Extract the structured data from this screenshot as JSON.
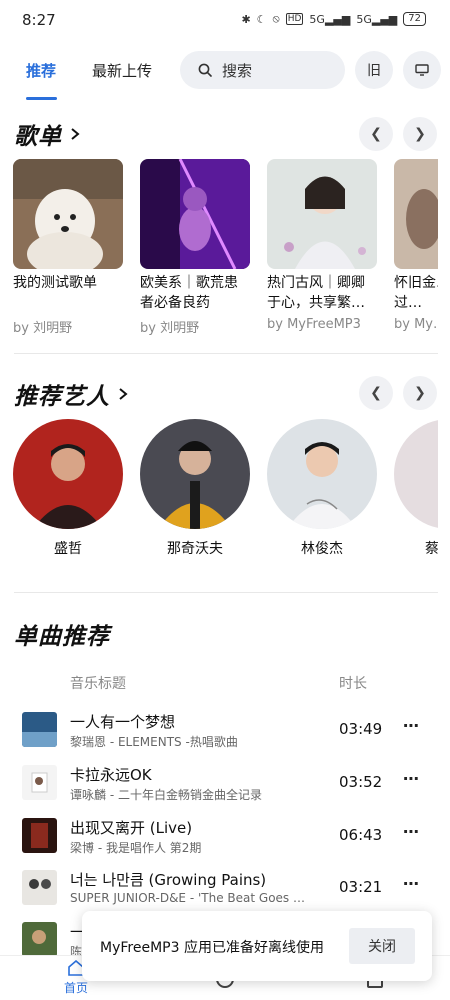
{
  "status_bar": {
    "time": "8:27",
    "signal_1": "5G",
    "signal_2": "5G",
    "hd": "HD",
    "battery": "72"
  },
  "nav": {
    "tabs": [
      {
        "label": "推荐",
        "active": true
      },
      {
        "label": "最新上传",
        "active": false
      }
    ],
    "search_placeholder": "搜索",
    "icon_button_1": "旧",
    "icon_button_2_icon": "monitor-icon"
  },
  "playlists": {
    "title": "歌单",
    "items": [
      {
        "name": "我的测试歌单",
        "by": "by 刘明野"
      },
      {
        "name": "欧美系｜歌荒患者必备良药",
        "by": "by 刘明野"
      },
      {
        "name": "热门古风｜卿卿于心，共享繁…",
        "by": "by MyFreeMP3"
      },
      {
        "name": "怀旧金…｜时过…",
        "by": "by My…"
      }
    ]
  },
  "artists": {
    "title": "推荐艺人",
    "items": [
      {
        "name": "盛哲"
      },
      {
        "name": "那奇沃夫"
      },
      {
        "name": "林俊杰"
      },
      {
        "name": "蔡"
      }
    ]
  },
  "songs": {
    "title": "单曲推荐",
    "col_title": "音乐标题",
    "col_duration": "时长",
    "items": [
      {
        "title": "一人有一个梦想",
        "sub": "黎瑞恩 - ELEMENTS -热唱歌曲",
        "duration": "03:49",
        "more": "⋯"
      },
      {
        "title": "卡拉永远OK",
        "sub": "谭咏麟 - 二十年白金畅销金曲全记录",
        "duration": "03:52",
        "more": "⋯"
      },
      {
        "title": "出现又离开 (Live)",
        "sub": "梁博 - 我是唱作人 第2期",
        "duration": "06:43",
        "more": "⋯"
      },
      {
        "title": "너는 나만큼 (Growing Pains)",
        "sub": "SUPER JUNIOR-D&E - 'The Beat Goes …",
        "duration": "03:21",
        "more": "⋯"
      },
      {
        "title": "一",
        "sub": "陈",
        "duration": "",
        "more": ""
      }
    ]
  },
  "toast": {
    "message": "MyFreeMP3 应用已准备好离线使用",
    "close_label": "关闭"
  },
  "bottom_nav": {
    "home_label": "首页"
  },
  "colors": {
    "accent": "#2a6fdb"
  }
}
